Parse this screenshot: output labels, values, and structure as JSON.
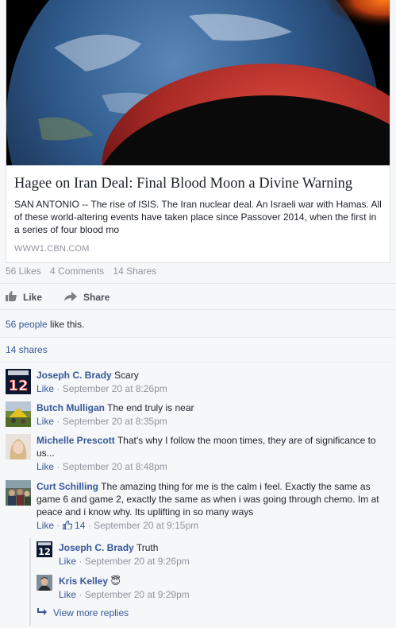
{
  "link_preview": {
    "image_icon": "blood-moon-earth-image",
    "title": "Hagee on Iran Deal: Final Blood Moon a Divine Warning",
    "description": "SAN ANTONIO -- The rise of ISIS. The Iran nuclear deal. An Israeli war with Hamas. All of these world-altering events have taken place since Passover 2014, when the first in a series of four blood mo",
    "domain": "WWW1.CBN.COM"
  },
  "stats": {
    "likes": "56 Likes",
    "comments": "4 Comments",
    "shares": "14 Shares"
  },
  "actions": {
    "like": "Like",
    "share": "Share"
  },
  "likes_summary": {
    "people": "56 people",
    "rest": " like this."
  },
  "shares_summary": "14 shares",
  "comments": [
    {
      "name": "Joseph C. Brady",
      "text": " Scary",
      "like": "Like",
      "time": "September 20 at 8:26pm",
      "avatar": "jersey-12-avatar"
    },
    {
      "name": "Butch Mulligan",
      "text": " The end truly is near",
      "like": "Like",
      "time": "September 20 at 8:35pm",
      "avatar": "outdoor-tent-avatar"
    },
    {
      "name": "Michelle Prescott",
      "text": " That's why I follow the moon times, they are of significance to us...",
      "like": "Like",
      "time": "September 20 at 8:48pm",
      "avatar": "woman-portrait-avatar"
    },
    {
      "name": "Curt Schilling",
      "text": " The amazing thing for me is the calm i feel. Exactly the same as game 6 and game 2, exactly the same as when i was going through chemo. Im at peace and i know why. Its uplifting in so many ways",
      "like": "Like",
      "like_count": "14",
      "time": "September 20 at 9:15pm",
      "avatar": "crowd-photo-avatar"
    }
  ],
  "replies": [
    {
      "name": "Joseph C. Brady",
      "text": " Truth",
      "like": "Like",
      "time": "September 20 at 9:26pm",
      "avatar": "jersey-12-avatar"
    },
    {
      "name": "Kris Kelley",
      "text": " ",
      "emoji": "😇",
      "like": "Like",
      "time": "September 20 at 9:29pm",
      "avatar": "man-portrait-avatar"
    }
  ],
  "view_more_replies": "View more replies",
  "colors": {
    "link_blue": "#365899",
    "meta_gray": "#90949c",
    "blood_moon": "#b02a2a"
  }
}
